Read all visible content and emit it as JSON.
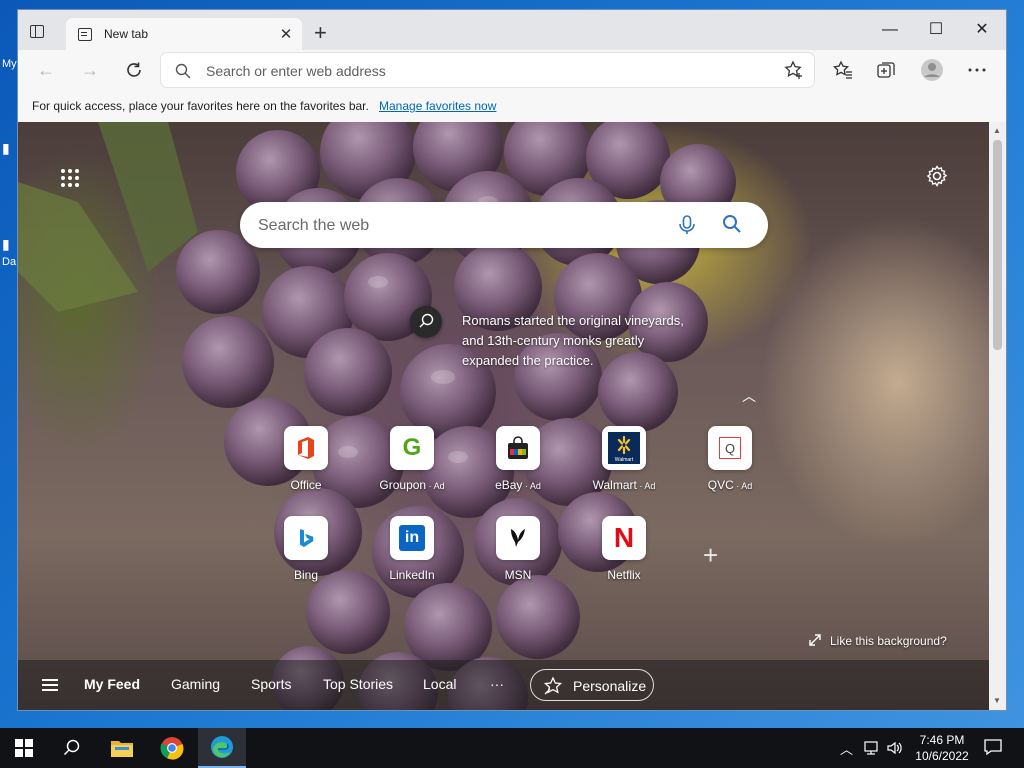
{
  "desktop": {
    "label_top": "My",
    "label_bottom": "Da"
  },
  "tab": {
    "title": "New tab",
    "close": "✕",
    "new_tab": "+"
  },
  "window_controls": {
    "minimize": "—",
    "maximize": "☐",
    "close": "✕"
  },
  "toolbar": {
    "back": "←",
    "forward": "→",
    "address_placeholder": "Search or enter web address"
  },
  "favorites_bar": {
    "text": "For quick access, place your favorites here on the favorites bar.",
    "link": "Manage favorites now"
  },
  "new_tab_page": {
    "search_placeholder": "Search the web",
    "fact_line1": "Romans started the original vineyards,",
    "fact_line2": "and 13th-century monks greatly",
    "fact_line3": "expanded the practice.",
    "collapse": "︿",
    "add_tile": "+",
    "like_background": "Like this background?",
    "tiles": [
      {
        "label": "Office",
        "ad": ""
      },
      {
        "label": "Groupon",
        "ad": " · Ad"
      },
      {
        "label": "eBay",
        "ad": " · Ad"
      },
      {
        "label": "Walmart",
        "ad": " · Ad"
      },
      {
        "label": "QVC",
        "ad": " · Ad"
      },
      {
        "label": "Bing",
        "ad": ""
      },
      {
        "label": "LinkedIn",
        "ad": ""
      },
      {
        "label": "MSN",
        "ad": ""
      },
      {
        "label": "Netflix",
        "ad": ""
      }
    ],
    "tile_glyphs": {
      "groupon": "G",
      "linkedin": "in",
      "netflix": "N",
      "walmart": "Walmart",
      "qvc": "Q"
    },
    "feed": {
      "items": [
        "My Feed",
        "Gaming",
        "Sports",
        "Top Stories",
        "Local"
      ],
      "more": "···",
      "personalize": "Personalize"
    }
  },
  "scrollbar": {
    "up": "▲",
    "down": "▼"
  },
  "taskbar": {
    "tray_up": "︿",
    "time": "7:46 PM",
    "date": "10/6/2022"
  },
  "colors": {
    "link": "#0067b8",
    "taskbar": "#101216",
    "desktop": "#1a76d0"
  }
}
